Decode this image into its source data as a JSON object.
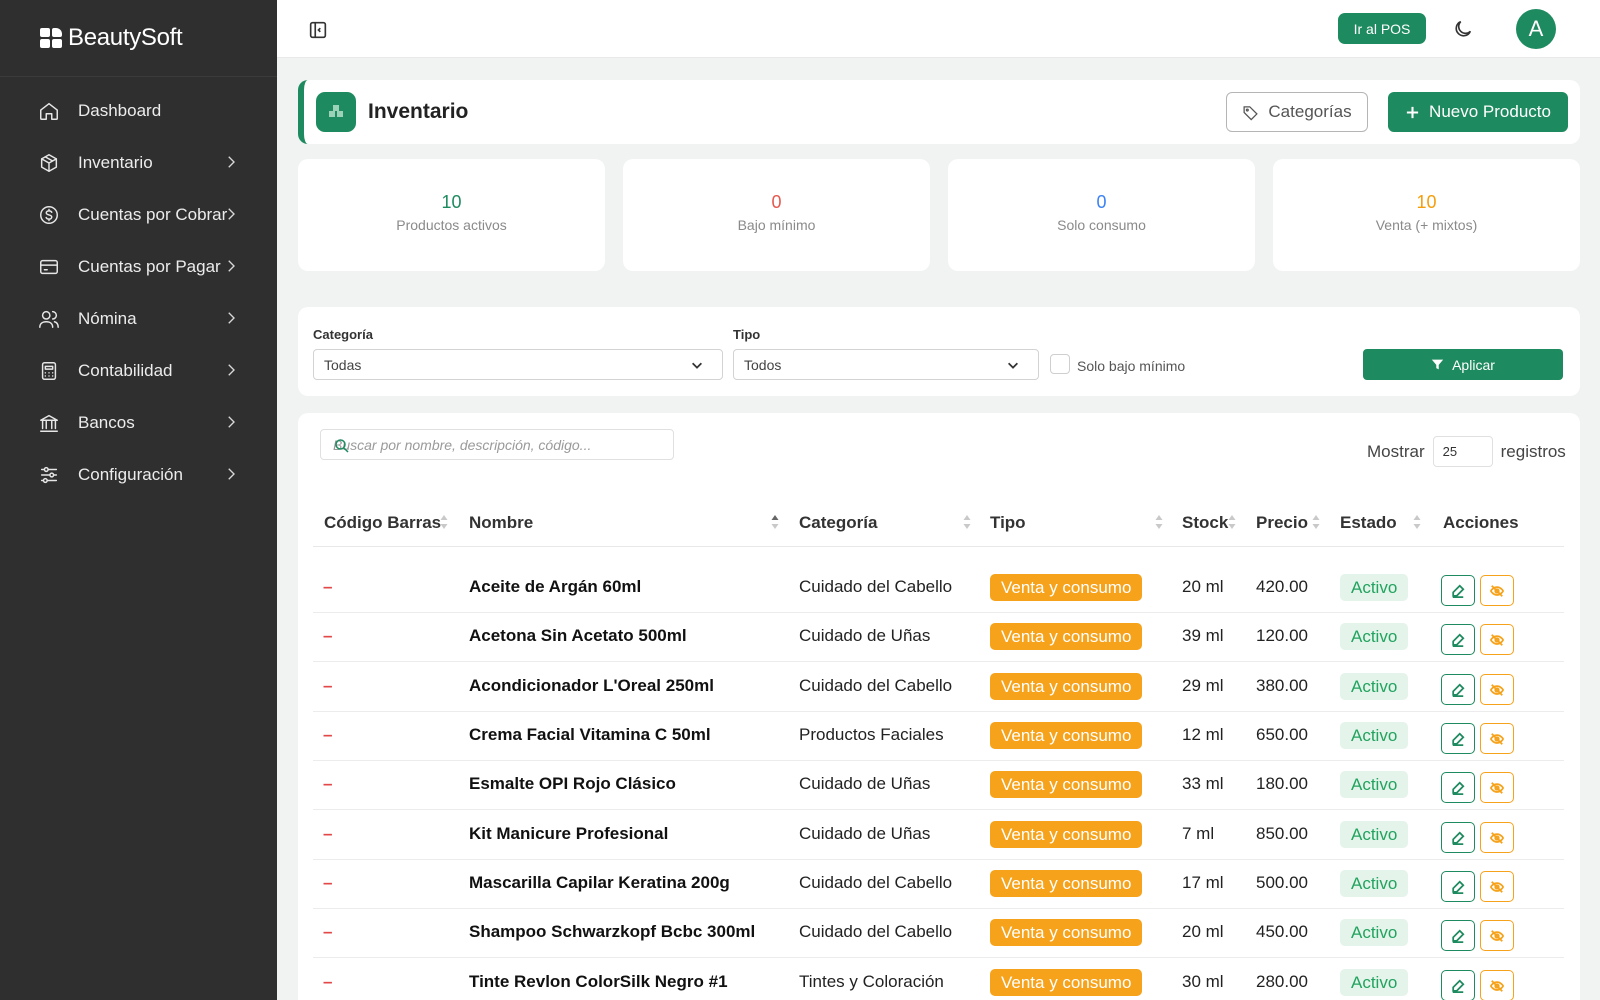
{
  "brand": {
    "name": "BeautySoft"
  },
  "sidebar": {
    "items": [
      {
        "label": "Dashboard",
        "icon": "home-icon"
      },
      {
        "label": "Inventario",
        "icon": "box-icon"
      },
      {
        "label": "Cuentas por Cobrar",
        "icon": "dollar-icon"
      },
      {
        "label": "Cuentas por Pagar",
        "icon": "credit-card-icon"
      },
      {
        "label": "Nómina",
        "icon": "users-icon"
      },
      {
        "label": "Contabilidad",
        "icon": "calculator-icon"
      },
      {
        "label": "Bancos",
        "icon": "bank-icon"
      },
      {
        "label": "Configuración",
        "icon": "sliders-icon"
      }
    ]
  },
  "topbar": {
    "pos_label": "Ir al POS",
    "avatar_initial": "A"
  },
  "header": {
    "title": "Inventario",
    "categories_label": "Categorías",
    "new_product_label": "Nuevo Producto"
  },
  "stats": [
    {
      "value": "10",
      "label": "Productos activos",
      "color": "#1e8a5f"
    },
    {
      "value": "0",
      "label": "Bajo mínimo",
      "color": "#e5584f"
    },
    {
      "value": "0",
      "label": "Solo consumo",
      "color": "#3b82f6"
    },
    {
      "value": "10",
      "label": "Venta (+ mixtos)",
      "color": "#f59e0b"
    }
  ],
  "filters": {
    "categoria_label": "Categoría",
    "categoria_value": "Todas",
    "tipo_label": "Tipo",
    "tipo_value": "Todos",
    "check_label": "Solo bajo mínimo",
    "apply_label": "Aplicar"
  },
  "table": {
    "search_placeholder": "Buscar por nombre, descripción, código...",
    "show_label": "Mostrar",
    "show_value": "25",
    "records_label": "registros",
    "columns": [
      "Código Barras",
      "Nombre",
      "Categoría",
      "Tipo",
      "Stock",
      "Precio",
      "Estado",
      "Acciones"
    ],
    "rows": [
      {
        "barcode": "–",
        "name": "Aceite de Argán 60ml",
        "category": "Cuidado del Cabello",
        "type": "Venta y consumo",
        "stock": "20 ml",
        "price": "420.00",
        "status": "Activo"
      },
      {
        "barcode": "–",
        "name": "Acetona Sin Acetato 500ml",
        "category": "Cuidado de Uñas",
        "type": "Venta y consumo",
        "stock": "39 ml",
        "price": "120.00",
        "status": "Activo"
      },
      {
        "barcode": "–",
        "name": "Acondicionador L'Oreal 250ml",
        "category": "Cuidado del Cabello",
        "type": "Venta y consumo",
        "stock": "29 ml",
        "price": "380.00",
        "status": "Activo"
      },
      {
        "barcode": "–",
        "name": "Crema Facial Vitamina C 50ml",
        "category": "Productos Faciales",
        "type": "Venta y consumo",
        "stock": "12 ml",
        "price": "650.00",
        "status": "Activo"
      },
      {
        "barcode": "–",
        "name": "Esmalte OPI Rojo Clásico",
        "category": "Cuidado de Uñas",
        "type": "Venta y consumo",
        "stock": "33 ml",
        "price": "180.00",
        "status": "Activo"
      },
      {
        "barcode": "–",
        "name": "Kit Manicure Profesional",
        "category": "Cuidado de Uñas",
        "type": "Venta y consumo",
        "stock": "7 ml",
        "price": "850.00",
        "status": "Activo"
      },
      {
        "barcode": "–",
        "name": "Mascarilla Capilar Keratina 200g",
        "category": "Cuidado del Cabello",
        "type": "Venta y consumo",
        "stock": "17 ml",
        "price": "500.00",
        "status": "Activo"
      },
      {
        "barcode": "–",
        "name": "Shampoo Schwarzkopf Bcbc 300ml",
        "category": "Cuidado del Cabello",
        "type": "Venta y consumo",
        "stock": "20 ml",
        "price": "450.00",
        "status": "Activo"
      },
      {
        "barcode": "–",
        "name": "Tinte Revlon ColorSilk Negro #1",
        "category": "Tintes y Coloración",
        "type": "Venta y consumo",
        "stock": "30 ml",
        "price": "280.00",
        "status": "Activo"
      }
    ]
  },
  "colors": {
    "primary": "#1e8a5f",
    "sidebar_bg": "#2f2f2f",
    "warning": "#f6a21a",
    "danger": "#e34848"
  }
}
